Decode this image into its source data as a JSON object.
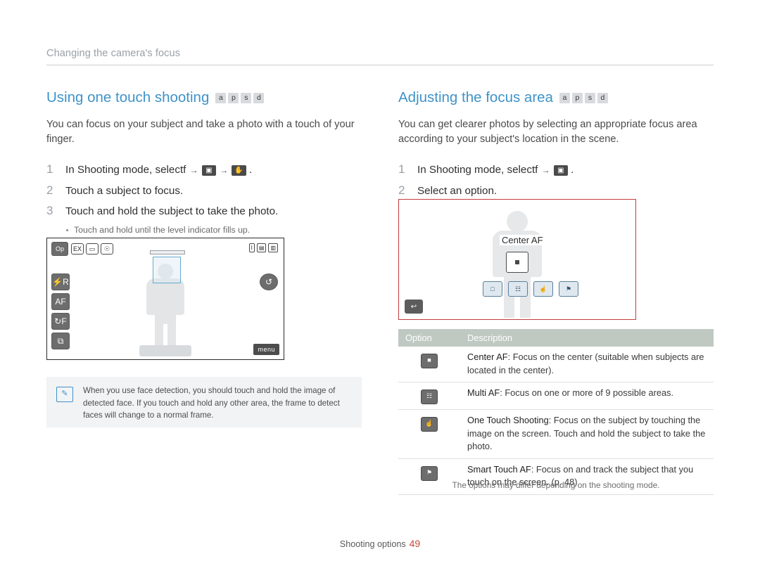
{
  "header": {
    "running_head": "Changing the camera's focus"
  },
  "left": {
    "title": "Using one touch shooting",
    "modes": [
      "a",
      "p",
      "s",
      "d"
    ],
    "intro": "You can focus on your subject and take a photo with a touch of your finger.",
    "steps": [
      {
        "num": "1",
        "text_before": "In Shooting mode, selectf",
        "text_after": "."
      },
      {
        "num": "2",
        "text": "Touch a subject to focus."
      },
      {
        "num": "3",
        "text": "Touch and hold the subject to take the photo."
      }
    ],
    "bullet_note": "Touch and hold until the level indicator fills up.",
    "camera_screen": {
      "icons_top": [
        "Op",
        "EX",
        "▭",
        "☉"
      ],
      "icons_left": [
        "⚡R",
        "AF",
        "↻F",
        "⧉"
      ],
      "icon_right": "↺",
      "battery_icons": [
        "I",
        "▤",
        "▥"
      ],
      "menu_label": "menu"
    },
    "note": "When you use face detection, you should touch and hold the image of detected face. If you touch and hold any other area, the frame to detect faces will change to a normal frame.",
    "note_icon": "note-icon"
  },
  "right": {
    "title": "Adjusting the focus area",
    "modes": [
      "a",
      "p",
      "s",
      "d"
    ],
    "intro": "You can get clearer photos by selecting an appropriate focus area according to your subject's location in the scene.",
    "steps": [
      {
        "num": "1",
        "text_before": "In Shooting mode, selectf",
        "text_after": "."
      },
      {
        "num": "2",
        "text": "Select an option."
      }
    ],
    "illustration": {
      "label": "Center AF",
      "options": [
        "□",
        "☷",
        "☝",
        "⚑"
      ],
      "back": "↩"
    },
    "table": {
      "headers": [
        "Option",
        "Description"
      ],
      "rows": [
        {
          "icon": "■",
          "name": "Center AF",
          "desc": ": Focus on the center (suitable when subjects are located in the center)."
        },
        {
          "icon": "☷",
          "name": "Multi AF",
          "desc": ": Focus on one or more of 9 possible areas."
        },
        {
          "icon": "☝",
          "name": "One Touch Shooting",
          "desc": ": Focus on the subject by touching the image on the screen. Touch and hold the subject to take the photo."
        },
        {
          "icon": "⚑",
          "name": "Smart Touch AF",
          "desc": ": Focus on and track the subject that you touch on the screen. (p. 48)"
        }
      ],
      "footnote": "The options may differ depending on the shooting mode."
    }
  },
  "footer": {
    "section": "Shooting options",
    "page": "49"
  },
  "colors": {
    "heading": "#3f93c8",
    "rule": "#c9ccd1",
    "table_header_bg": "#bfc9c2",
    "illustration_border": "#c33c3c",
    "page_number": "#c44a3a"
  }
}
